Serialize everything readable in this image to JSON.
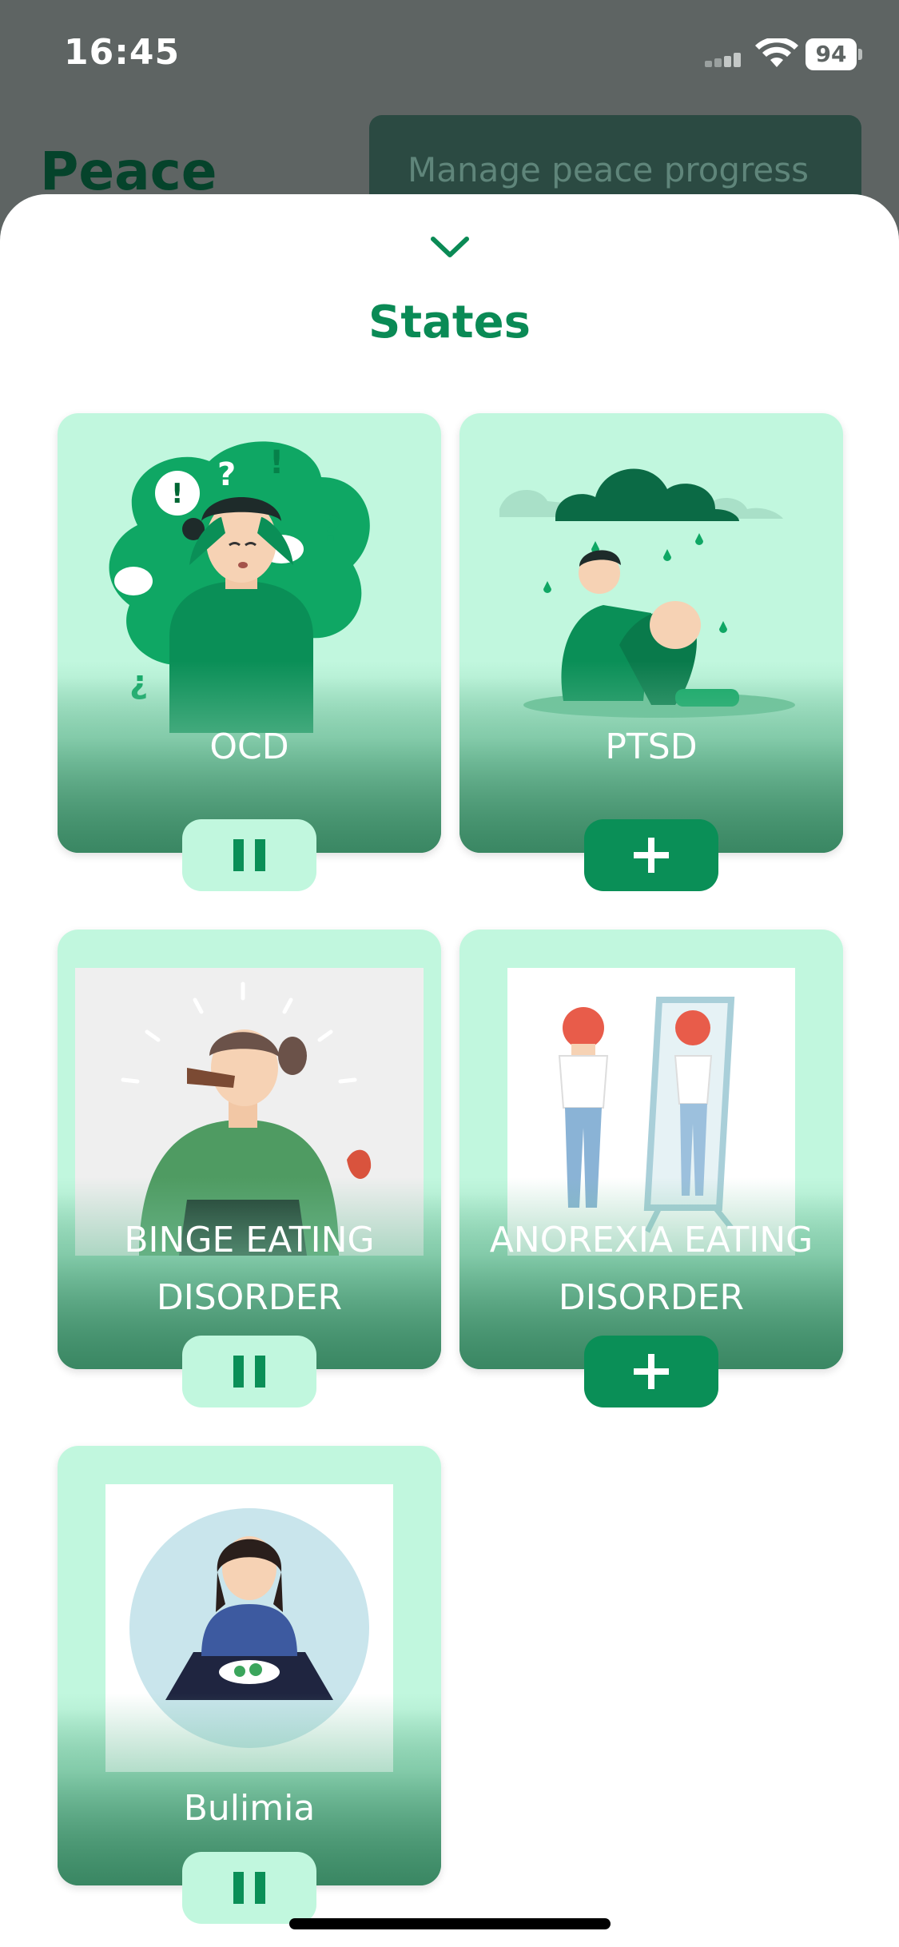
{
  "status_bar": {
    "time": "16:45",
    "battery": "94"
  },
  "background": {
    "title": "Peace",
    "manage_button": "Manage peace progress"
  },
  "sheet": {
    "title": "States"
  },
  "cards": [
    {
      "label": "OCD",
      "action": "pause"
    },
    {
      "label": "PTSD",
      "action": "add"
    },
    {
      "label": "BINGE EATING DISORDER",
      "action": "pause"
    },
    {
      "label": "ANOREXIA EATING DISORDER",
      "action": "add"
    },
    {
      "label": "Bulimia",
      "action": "pause"
    }
  ],
  "colors": {
    "accent": "#0a8a55",
    "card_bg": "#c1f7de",
    "card_bottom": "#3f8a66",
    "scrim": "#5e6463"
  }
}
